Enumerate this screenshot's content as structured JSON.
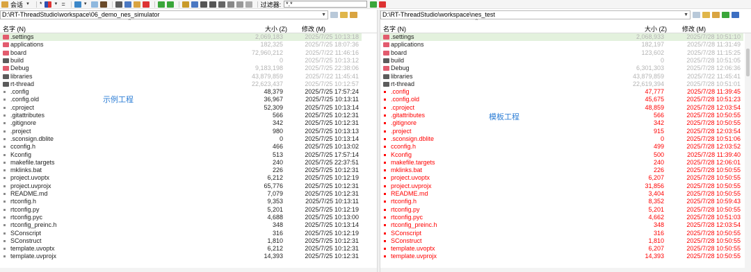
{
  "toolbar": {
    "session_label": "会话",
    "star_label": "*",
    "equals_label": "=",
    "filter_label": "过滤器:",
    "filter_value": "*.*"
  },
  "left": {
    "path": "D:\\RT-ThreadStudio\\workspace\\06_demo_nes_simulator",
    "col_name": "名字 (N)",
    "col_size": "大小 (Z)",
    "col_date": "修改 (M)",
    "annotation": "示例工程",
    "rows": [
      {
        "name": ".settings",
        "size": "2,069,183",
        "date": "2025/7/25 10:13:18",
        "kind": "folder-red",
        "tone": "gray"
      },
      {
        "name": "applications",
        "size": "182,325",
        "date": "2025/7/25 18:07:36",
        "kind": "folder-red",
        "tone": "gray"
      },
      {
        "name": "board",
        "size": "72,960,212",
        "date": "2025/7/22 11:46:16",
        "kind": "folder-red",
        "tone": "gray"
      },
      {
        "name": "build",
        "size": "0",
        "date": "2025/7/25 10:13:12",
        "kind": "folder-dark",
        "tone": "gray"
      },
      {
        "name": "Debug",
        "size": "9,183,198",
        "date": "2025/7/25 22:38:06",
        "kind": "folder-red",
        "tone": "gray"
      },
      {
        "name": "libraries",
        "size": "43,879,859",
        "date": "2025/7/22 11:45:41",
        "kind": "folder-dark",
        "tone": "gray"
      },
      {
        "name": "rt-thread",
        "size": "22,623,437",
        "date": "2025/7/25 10:12:57",
        "kind": "folder-dark",
        "tone": "gray"
      },
      {
        "name": ".config",
        "size": "48,379",
        "date": "2025/7/25 17:57:24",
        "kind": "file",
        "tone": "black"
      },
      {
        "name": ".config.old",
        "size": "36,967",
        "date": "2025/7/25 10:13:11",
        "kind": "file",
        "tone": "black"
      },
      {
        "name": ".cproject",
        "size": "52,309",
        "date": "2025/7/25 10:13:14",
        "kind": "file",
        "tone": "black"
      },
      {
        "name": ".gitattributes",
        "size": "566",
        "date": "2025/7/25 10:12:31",
        "kind": "file",
        "tone": "black"
      },
      {
        "name": ".gitignore",
        "size": "342",
        "date": "2025/7/25 10:12:31",
        "kind": "file",
        "tone": "black"
      },
      {
        "name": ".project",
        "size": "980",
        "date": "2025/7/25 10:13:13",
        "kind": "file",
        "tone": "black"
      },
      {
        "name": ".sconsign.dblite",
        "size": "0",
        "date": "2025/7/25 10:13:14",
        "kind": "file",
        "tone": "black"
      },
      {
        "name": "cconfig.h",
        "size": "466",
        "date": "2025/7/25 10:13:02",
        "kind": "file",
        "tone": "black"
      },
      {
        "name": "Kconfig",
        "size": "513",
        "date": "2025/7/25 17:57:14",
        "kind": "file",
        "tone": "black"
      },
      {
        "name": "makefile.targets",
        "size": "240",
        "date": "2025/7/25 22:37:51",
        "kind": "file",
        "tone": "black"
      },
      {
        "name": "mklinks.bat",
        "size": "226",
        "date": "2025/7/25 10:12:31",
        "kind": "file",
        "tone": "black"
      },
      {
        "name": "project.uvoptx",
        "size": "6,212",
        "date": "2025/7/25 10:12:19",
        "kind": "file",
        "tone": "black"
      },
      {
        "name": "project.uvprojx",
        "size": "65,776",
        "date": "2025/7/25 10:12:31",
        "kind": "file",
        "tone": "black"
      },
      {
        "name": "README.md",
        "size": "7,079",
        "date": "2025/7/25 10:12:31",
        "kind": "file",
        "tone": "black"
      },
      {
        "name": "rtconfig.h",
        "size": "9,353",
        "date": "2025/7/25 10:13:11",
        "kind": "file",
        "tone": "black"
      },
      {
        "name": "rtconfig.py",
        "size": "5,201",
        "date": "2025/7/25 10:12:19",
        "kind": "file",
        "tone": "black"
      },
      {
        "name": "rtconfig.pyc",
        "size": "4,688",
        "date": "2025/7/25 10:13:00",
        "kind": "file",
        "tone": "black"
      },
      {
        "name": "rtconfig_preinc.h",
        "size": "348",
        "date": "2025/7/25 10:13:14",
        "kind": "file",
        "tone": "black"
      },
      {
        "name": "SConscript",
        "size": "316",
        "date": "2025/7/25 10:12:19",
        "kind": "file",
        "tone": "black"
      },
      {
        "name": "SConstruct",
        "size": "1,810",
        "date": "2025/7/25 10:12:31",
        "kind": "file",
        "tone": "black"
      },
      {
        "name": "template.uvoptx",
        "size": "6,212",
        "date": "2025/7/25 10:12:31",
        "kind": "file",
        "tone": "black"
      },
      {
        "name": "template.uvprojx",
        "size": "14,393",
        "date": "2025/7/25 10:12:31",
        "kind": "file",
        "tone": "black"
      }
    ]
  },
  "right": {
    "path": "D:\\RT-ThreadStudio\\workspace\\nes_test",
    "col_name": "名字 (N)",
    "col_size": "大小 (Z)",
    "col_date": "修改 (M)",
    "annotation": "模板工程",
    "rows": [
      {
        "name": ".settings",
        "size": "2,068,933",
        "date": "2025/7/28 10:51:10",
        "kind": "folder-red",
        "tone": "gray"
      },
      {
        "name": "applications",
        "size": "182,197",
        "date": "2025/7/28 11:31:49",
        "kind": "folder-red",
        "tone": "gray"
      },
      {
        "name": "board",
        "size": "123,602",
        "date": "2025/7/28 11:15:25",
        "kind": "folder-red",
        "tone": "gray"
      },
      {
        "name": "build",
        "size": "0",
        "date": "2025/7/28 10:51:05",
        "kind": "folder-dark",
        "tone": "gray"
      },
      {
        "name": "Debug",
        "size": "6,301,303",
        "date": "2025/7/28 12:06:36",
        "kind": "folder-red",
        "tone": "gray"
      },
      {
        "name": "libraries",
        "size": "43,879,859",
        "date": "2025/7/22 11:45:41",
        "kind": "folder-dark",
        "tone": "gray"
      },
      {
        "name": "rt-thread",
        "size": "22,619,394",
        "date": "2025/7/28 10:51:01",
        "kind": "folder-dark",
        "tone": "gray"
      },
      {
        "name": ".config",
        "size": "47,777",
        "date": "2025/7/28 11:39:45",
        "kind": "file",
        "tone": "red"
      },
      {
        "name": ".config.old",
        "size": "45,675",
        "date": "2025/7/28 10:51:23",
        "kind": "file",
        "tone": "red"
      },
      {
        "name": ".cproject",
        "size": "48,859",
        "date": "2025/7/28 12:03:54",
        "kind": "file",
        "tone": "red"
      },
      {
        "name": ".gitattributes",
        "size": "566",
        "date": "2025/7/28 10:50:55",
        "kind": "file",
        "tone": "red"
      },
      {
        "name": ".gitignore",
        "size": "342",
        "date": "2025/7/28 10:50:55",
        "kind": "file",
        "tone": "red"
      },
      {
        "name": ".project",
        "size": "915",
        "date": "2025/7/28 12:03:54",
        "kind": "file",
        "tone": "red"
      },
      {
        "name": ".sconsign.dblite",
        "size": "0",
        "date": "2025/7/28 10:51:06",
        "kind": "file",
        "tone": "red"
      },
      {
        "name": "cconfig.h",
        "size": "499",
        "date": "2025/7/28 12:03:52",
        "kind": "file",
        "tone": "red"
      },
      {
        "name": "Kconfig",
        "size": "500",
        "date": "2025/7/28 11:39:40",
        "kind": "file",
        "tone": "red"
      },
      {
        "name": "makefile.targets",
        "size": "240",
        "date": "2025/7/28 12:06:01",
        "kind": "file",
        "tone": "red"
      },
      {
        "name": "mklinks.bat",
        "size": "226",
        "date": "2025/7/28 10:50:55",
        "kind": "file",
        "tone": "red"
      },
      {
        "name": "project.uvoptx",
        "size": "6,207",
        "date": "2025/7/28 10:50:55",
        "kind": "file",
        "tone": "red"
      },
      {
        "name": "project.uvprojx",
        "size": "31,856",
        "date": "2025/7/28 10:50:55",
        "kind": "file",
        "tone": "red"
      },
      {
        "name": "README.md",
        "size": "3,404",
        "date": "2025/7/28 10:50:55",
        "kind": "file",
        "tone": "red"
      },
      {
        "name": "rtconfig.h",
        "size": "8,352",
        "date": "2025/7/28 10:59:43",
        "kind": "file",
        "tone": "red"
      },
      {
        "name": "rtconfig.py",
        "size": "5,201",
        "date": "2025/7/28 10:50:55",
        "kind": "file",
        "tone": "red"
      },
      {
        "name": "rtconfig.pyc",
        "size": "4,662",
        "date": "2025/7/28 10:51:03",
        "kind": "file",
        "tone": "red"
      },
      {
        "name": "rtconfig_preinc.h",
        "size": "348",
        "date": "2025/7/28 12:03:54",
        "kind": "file",
        "tone": "red"
      },
      {
        "name": "SConscript",
        "size": "316",
        "date": "2025/7/28 10:50:55",
        "kind": "file",
        "tone": "red"
      },
      {
        "name": "SConstruct",
        "size": "1,810",
        "date": "2025/7/28 10:50:55",
        "kind": "file",
        "tone": "red"
      },
      {
        "name": "template.uvoptx",
        "size": "6,207",
        "date": "2025/7/28 10:50:55",
        "kind": "file",
        "tone": "red"
      },
      {
        "name": "template.uvprojx",
        "size": "14,393",
        "date": "2025/7/28 10:50:55",
        "kind": "file",
        "tone": "red"
      }
    ]
  },
  "colors": {
    "folder_red": "#e25c6e",
    "folder_dark": "#5c5c5c",
    "diff_red": "#ff0000",
    "annotation_blue": "#2f7fd6",
    "selected_row": "#e3f1dd"
  }
}
